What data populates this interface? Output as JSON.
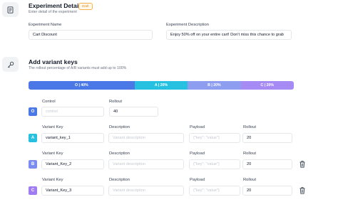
{
  "details": {
    "title": "Experiment Details",
    "status_badge": "Draft",
    "subtitle": "Enter detail of the experiment",
    "name_label": "Experiment Name",
    "name_value": "Cart Discount",
    "description_label": "Experiment Description",
    "description_value": "Enjoy 50% off on your entire cart! Don't miss this chance to grab"
  },
  "variants_section": {
    "title": "Add variant keys",
    "subtitle": "The rollout percentage of A/B variants must add up to 100%",
    "bar": [
      {
        "label": "O | 40%",
        "percent": 40,
        "color": "#4a78e6"
      },
      {
        "label": "A | 20%",
        "percent": 20,
        "color": "#26c0e0"
      },
      {
        "label": "B | 20%",
        "percent": 20,
        "color": "#8d9ef0"
      },
      {
        "label": "C | 20%",
        "percent": 20,
        "color": "#a78bf5"
      }
    ]
  },
  "control": {
    "badge": "O",
    "badge_color": "#4a78e6",
    "control_label": "Control",
    "control_placeholder": "control",
    "rollout_label": "Rollout",
    "rollout_value": "40"
  },
  "variants": [
    {
      "badge": "A",
      "badge_color": "#26c0e0",
      "key_label": "Variant Key",
      "key_value": "variant_key_1",
      "desc_label": "Description",
      "desc_placeholder": "Variant description",
      "payload_label": "Payload",
      "payload_placeholder": "{\"key\": \"value\"}",
      "rollout_label": "Rollout",
      "rollout_value": "20",
      "deletable": false
    },
    {
      "badge": "B",
      "badge_color": "#7c8df0",
      "key_label": "Variant Key",
      "key_value": "Variant_Key_2",
      "desc_label": "Description",
      "desc_placeholder": "Variant description",
      "payload_label": "Payload",
      "payload_placeholder": "{\"key\": \"value\"}",
      "rollout_label": "Rollout",
      "rollout_value": "20",
      "deletable": true
    },
    {
      "badge": "C",
      "badge_color": "#9f7cf2",
      "key_label": "Variant Key",
      "key_value": "Variant_Key_3",
      "desc_label": "Description",
      "desc_placeholder": "Variant description",
      "payload_label": "Payload",
      "payload_placeholder": "{\"key\": \"value\"}",
      "rollout_label": "Rollout",
      "rollout_value": "20",
      "deletable": true
    }
  ],
  "icons": {
    "details_icon": "document-icon",
    "variants_icon": "key-icon",
    "delete_icon": "trash-icon"
  }
}
